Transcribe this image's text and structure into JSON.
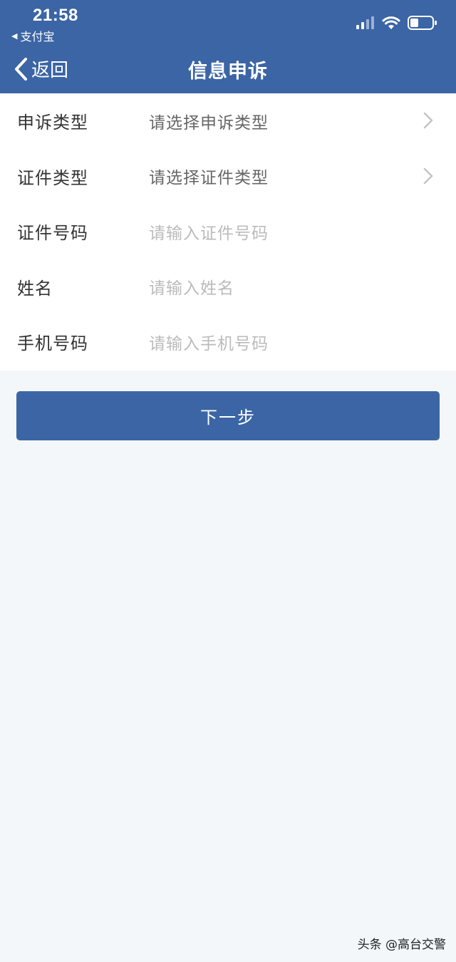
{
  "status_bar": {
    "time": "21:58",
    "back_app": "支付宝"
  },
  "nav": {
    "back_label": "返回",
    "title": "信息申诉"
  },
  "form": {
    "rows": [
      {
        "label": "申诉类型",
        "value": "请选择申诉类型"
      },
      {
        "label": "证件类型",
        "value": "请选择证件类型"
      },
      {
        "label": "证件号码",
        "placeholder": "请输入证件号码"
      },
      {
        "label": "姓名",
        "placeholder": "请输入姓名"
      },
      {
        "label": "手机号码",
        "placeholder": "请输入手机号码"
      }
    ]
  },
  "button": {
    "next_label": "下一步"
  },
  "watermark": "头条 @高台交警",
  "colors": {
    "brand": "#3b65a5",
    "page_bg": "#f3f7fa",
    "placeholder": "#bbbbbb"
  },
  "icons": [
    "back-chevron-icon",
    "chevron-right-icon",
    "signal-icon",
    "wifi-icon",
    "battery-icon"
  ]
}
